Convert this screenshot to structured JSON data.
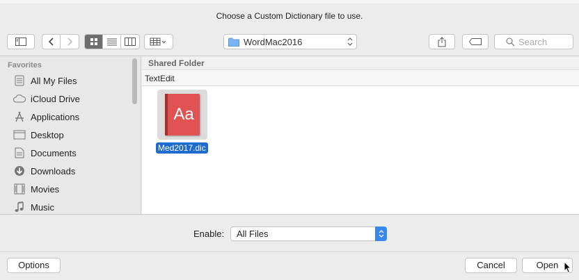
{
  "dialog": {
    "title": "Choose a Custom Dictionary file to use."
  },
  "toolbar": {
    "location": "WordMac2016",
    "search_placeholder": "Search"
  },
  "sidebar": {
    "section": "Favorites",
    "items": [
      {
        "label": "All My Files",
        "icon": "all-files-icon"
      },
      {
        "label": "iCloud Drive",
        "icon": "cloud-icon"
      },
      {
        "label": "Applications",
        "icon": "applications-icon"
      },
      {
        "label": "Desktop",
        "icon": "desktop-icon"
      },
      {
        "label": "Documents",
        "icon": "documents-icon"
      },
      {
        "label": "Downloads",
        "icon": "downloads-icon"
      },
      {
        "label": "Movies",
        "icon": "movies-icon"
      },
      {
        "label": "Music",
        "icon": "music-icon"
      }
    ]
  },
  "browser": {
    "group_header": "Shared Folder",
    "subfolder": "TextEdit",
    "files": [
      {
        "name": "Med2017.dic",
        "icon_text": "Aa",
        "selected": true
      }
    ]
  },
  "enable": {
    "label": "Enable:",
    "value": "All Files"
  },
  "buttons": {
    "options": "Options",
    "cancel": "Cancel",
    "open": "Open"
  },
  "colors": {
    "selection": "#1f6bd0",
    "file_icon": "#e15252",
    "stepper": "#3a86f0"
  }
}
